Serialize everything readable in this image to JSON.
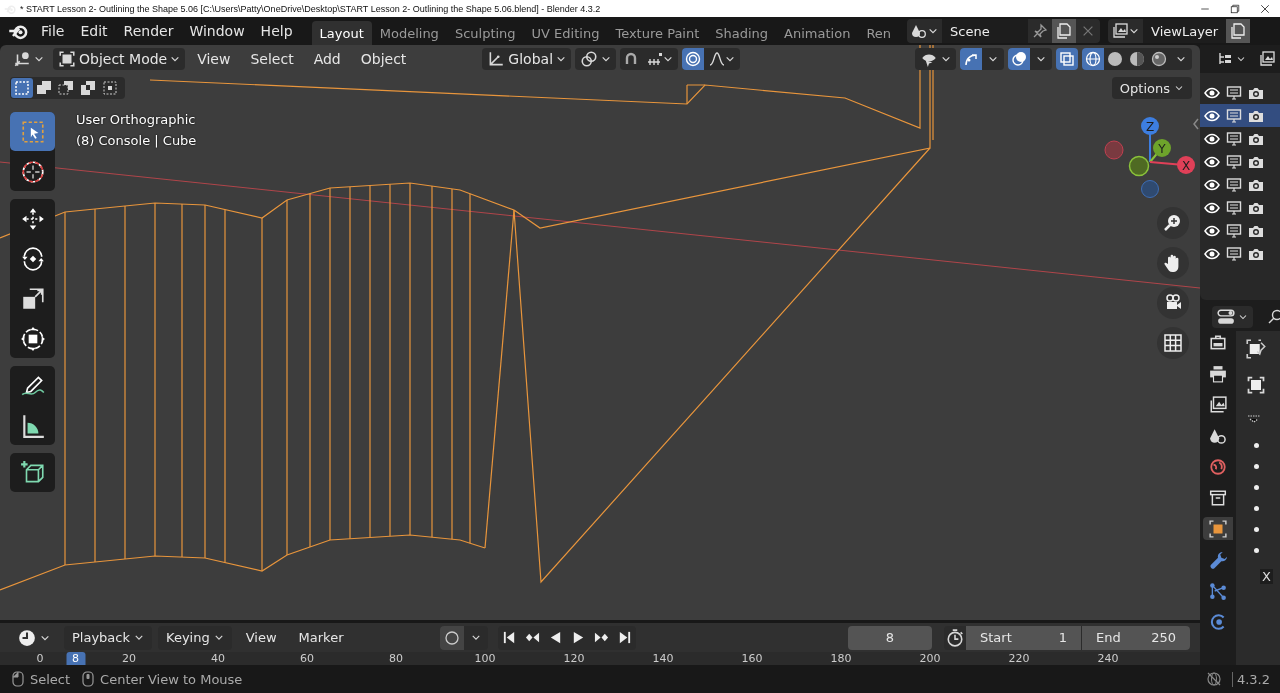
{
  "window": {
    "title": "* START  Lesson 2- Outlining the Shape  5.06 [C:\\Users\\Patty\\OneDrive\\Desktop\\START  Lesson 2- Outlining the Shape  5.06.blend] - Blender 4.3.2"
  },
  "menu": [
    "File",
    "Edit",
    "Render",
    "Window",
    "Help"
  ],
  "workspaces": [
    {
      "label": "Layout",
      "selected": true
    },
    {
      "label": "Modeling",
      "selected": false
    },
    {
      "label": "Sculpting",
      "selected": false
    },
    {
      "label": "UV Editing",
      "selected": false
    },
    {
      "label": "Texture Paint",
      "selected": false
    },
    {
      "label": "Shading",
      "selected": false
    },
    {
      "label": "Animation",
      "selected": false
    },
    {
      "label": "Ren",
      "selected": false
    }
  ],
  "scene": {
    "name": "Scene"
  },
  "view_layer": {
    "name": "ViewLayer"
  },
  "viewport_header": {
    "mode": "Object Mode",
    "menus": [
      "View",
      "Select",
      "Add",
      "Object"
    ],
    "orientation": "Global",
    "toggles": [
      {
        "kind": "snap",
        "on": false
      },
      {
        "kind": "proportional",
        "on": true
      }
    ],
    "display": [
      {
        "kind": "gizmo",
        "on": true
      },
      {
        "kind": "overlay",
        "on": true
      },
      {
        "kind": "xray",
        "on": true
      }
    ],
    "shading": [
      {
        "kind": "wireframe",
        "selected": true
      },
      {
        "kind": "solid",
        "selected": false
      },
      {
        "kind": "material",
        "selected": false
      },
      {
        "kind": "rendered",
        "selected": false
      }
    ]
  },
  "select_modes": [
    {
      "kind": "new",
      "selected": true
    },
    {
      "kind": "extend",
      "selected": false
    },
    {
      "kind": "subtract",
      "selected": false
    },
    {
      "kind": "invert",
      "selected": false
    },
    {
      "kind": "intersect",
      "selected": false
    }
  ],
  "tool_groups": [
    {
      "tools": [
        {
          "kind": "select-box",
          "selected": true
        },
        {
          "kind": "cursor",
          "selected": false
        }
      ]
    },
    {
      "tools": [
        {
          "kind": "move",
          "selected": false
        },
        {
          "kind": "rotate",
          "selected": false
        },
        {
          "kind": "scale",
          "selected": false
        },
        {
          "kind": "transform",
          "selected": false
        }
      ]
    },
    {
      "tools": [
        {
          "kind": "annotate",
          "selected": false
        },
        {
          "kind": "measure",
          "selected": false
        }
      ]
    },
    {
      "tools": [
        {
          "kind": "add-cube",
          "selected": false
        }
      ]
    }
  ],
  "viewport_info": [
    "User Orthographic",
    "(8) Console | Cube"
  ],
  "options_label": "Options",
  "axis_gizmo": {
    "labels": [
      "Z",
      "Y",
      "X"
    ]
  },
  "outliner_rows": [
    {
      "selected": false
    },
    {
      "selected": true
    },
    {
      "selected": false
    },
    {
      "selected": false
    },
    {
      "selected": false
    },
    {
      "selected": false
    },
    {
      "selected": false
    },
    {
      "selected": false
    }
  ],
  "properties_tabs": [
    {
      "kind": "tool",
      "selected": false
    },
    {
      "kind": "output",
      "selected": false
    },
    {
      "kind": "view-layer",
      "selected": false
    },
    {
      "kind": "scene",
      "selected": false
    },
    {
      "kind": "world",
      "selected": false
    },
    {
      "kind": "collection",
      "selected": false
    },
    {
      "kind": "object",
      "selected": true
    },
    {
      "kind": "modifier",
      "selected": false
    },
    {
      "kind": "particles",
      "selected": false
    },
    {
      "kind": "physics",
      "selected": false
    }
  ],
  "properties_field_label": "X",
  "timeline": {
    "menus": [
      {
        "label": "Playback",
        "dropdown": true
      },
      {
        "label": "Keying",
        "dropdown": true
      },
      {
        "label": "View",
        "dropdown": false
      },
      {
        "label": "Marker",
        "dropdown": false
      }
    ],
    "auto_key": false,
    "current_frame": "8",
    "start_label": "Start",
    "start": "1",
    "end_label": "End",
    "end": "250",
    "ruler": [
      "0",
      "20",
      "40",
      "60",
      "80",
      "100",
      "120",
      "140",
      "160",
      "180",
      "200",
      "220",
      "240"
    ],
    "playhead": "8"
  },
  "status_bar": {
    "hints": [
      "Select",
      "Center View to Mouse"
    ],
    "version": "4.3.2"
  }
}
